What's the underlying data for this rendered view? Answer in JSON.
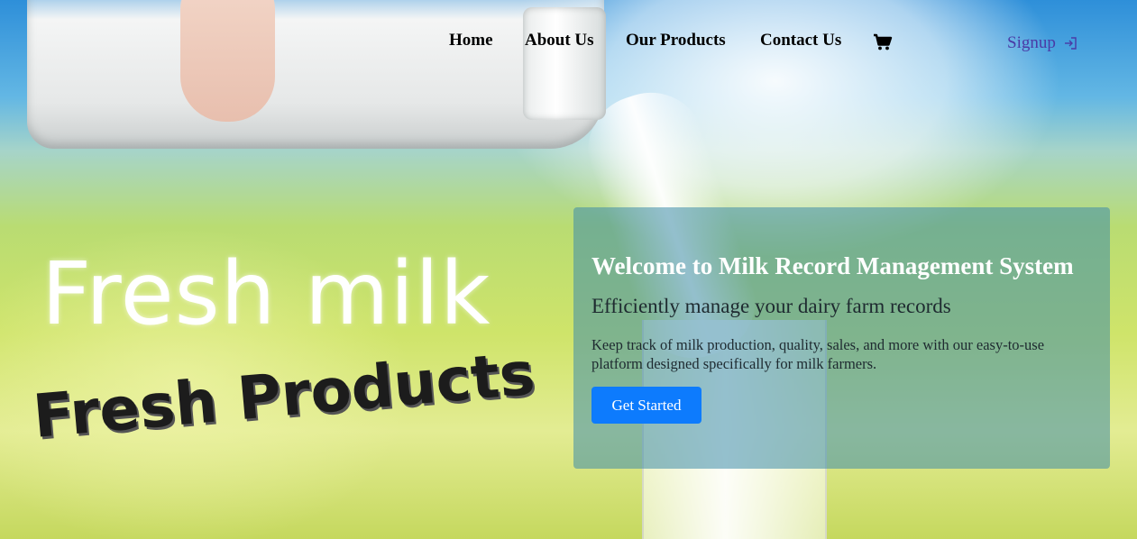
{
  "nav": {
    "links": [
      "Home",
      "About Us",
      "Our Products",
      "Contact Us"
    ],
    "cart_icon": "shopping-cart-icon",
    "signup_label": "Signup",
    "signup_icon": "sign-in-icon"
  },
  "hero": {
    "headline_white": "Fresh milk",
    "headline_dark": "Fresh Products"
  },
  "welcome": {
    "title": "Welcome to Milk Record Management System",
    "subtitle": "Efficiently manage your dairy farm records",
    "description": "Keep track of milk production, quality, sales, and more with our easy-to-use platform designed specifically for milk farmers.",
    "cta_label": "Get Started"
  },
  "colors": {
    "cta_button": "#0d7bfd",
    "signup_text": "#4a3aa6",
    "panel_overlay": "#3e8caa"
  }
}
